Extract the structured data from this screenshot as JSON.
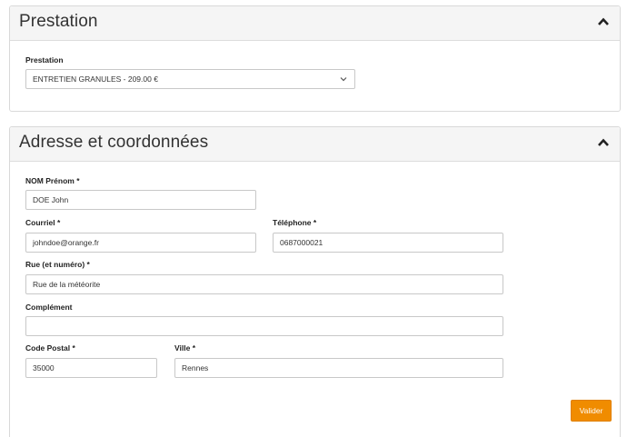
{
  "prestation_section": {
    "title": "Prestation",
    "field_label": "Prestation",
    "selected_value": "ENTRETIEN GRANULES - 209.00 €"
  },
  "address_section": {
    "title": "Adresse et coordonnées",
    "nom_label": "NOM Prénom *",
    "nom_value": "DOE John",
    "courriel_label": "Courriel *",
    "courriel_value": "johndoe@orange.fr",
    "telephone_label": "Téléphone *",
    "telephone_value": "0687000021",
    "rue_label": "Rue (et numéro) *",
    "rue_value": "Rue de la météorite",
    "complement_label": "Complément",
    "complement_value": "",
    "code_postal_label": "Code Postal *",
    "code_postal_value": "35000",
    "ville_label": "Ville *",
    "ville_value": "Rennes"
  },
  "actions": {
    "submit_label": "Valider"
  },
  "icons": {
    "collapse": "chevron-up-icon",
    "dropdown": "chevron-down-icon"
  },
  "colors": {
    "accent": "#f08c00",
    "panel_header_bg": "#f5f5f5",
    "border": "#d9d9d9"
  }
}
